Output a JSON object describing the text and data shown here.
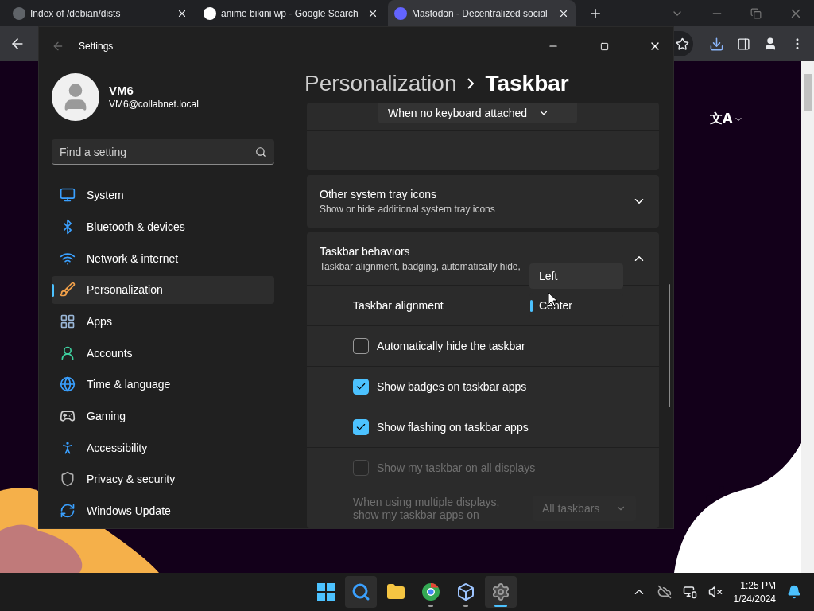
{
  "browser": {
    "tabs": [
      {
        "title": "Index of /debian/dists",
        "selected": false
      },
      {
        "title": "anime bikini wp - Google Search",
        "selected": false
      },
      {
        "title": "Mastodon - Decentralized social",
        "selected": true
      }
    ],
    "page": {
      "language_button": "文A"
    }
  },
  "settings": {
    "title": "Settings",
    "user": {
      "name": "VM6",
      "email": "VM6@collabnet.local"
    },
    "search": {
      "placeholder": "Find a setting"
    },
    "nav": [
      {
        "label": "System",
        "selected": false
      },
      {
        "label": "Bluetooth & devices",
        "selected": false
      },
      {
        "label": "Network & internet",
        "selected": false
      },
      {
        "label": "Personalization",
        "selected": true
      },
      {
        "label": "Apps",
        "selected": false
      },
      {
        "label": "Accounts",
        "selected": false
      },
      {
        "label": "Time & language",
        "selected": false
      },
      {
        "label": "Gaming",
        "selected": false
      },
      {
        "label": "Accessibility",
        "selected": false
      },
      {
        "label": "Privacy & security",
        "selected": false
      },
      {
        "label": "Windows Update",
        "selected": false
      }
    ],
    "breadcrumb": [
      "Personalization",
      "Taskbar"
    ],
    "keyboard_dropdown": "When no keyboard attached",
    "sections": [
      {
        "title": "Other system tray icons",
        "subtitle": "Show or hide additional system tray icons",
        "expanded": false
      },
      {
        "title": "Taskbar behaviors",
        "subtitle": "Taskbar alignment, badging, automatically hide,",
        "expanded": true
      }
    ],
    "alignment": {
      "label": "Taskbar alignment",
      "options": [
        {
          "label": "Left",
          "selected": false
        },
        {
          "label": "Center",
          "selected": true
        }
      ]
    },
    "checkboxes": [
      {
        "label": "Automatically hide the taskbar",
        "checked": false,
        "disabled": false
      },
      {
        "label": "Show badges on taskbar apps",
        "checked": true,
        "disabled": false
      },
      {
        "label": "Show flashing on taskbar apps",
        "checked": true,
        "disabled": false
      },
      {
        "label": "Show my taskbar on all displays",
        "checked": false,
        "disabled": true
      }
    ],
    "multi_display": {
      "label": "When using multiple displays, show my taskbar apps on",
      "value": "All taskbars",
      "disabled": true
    }
  },
  "taskbar": {
    "apps": [
      {
        "running": false,
        "selected": false
      },
      {
        "running": false,
        "selected": true
      },
      {
        "running": false,
        "selected": false
      },
      {
        "running": true,
        "selected": false
      },
      {
        "running": true,
        "selected": false
      },
      {
        "running": true,
        "selected": true
      }
    ],
    "time": "1:25 PM",
    "date": "1/24/2024"
  }
}
